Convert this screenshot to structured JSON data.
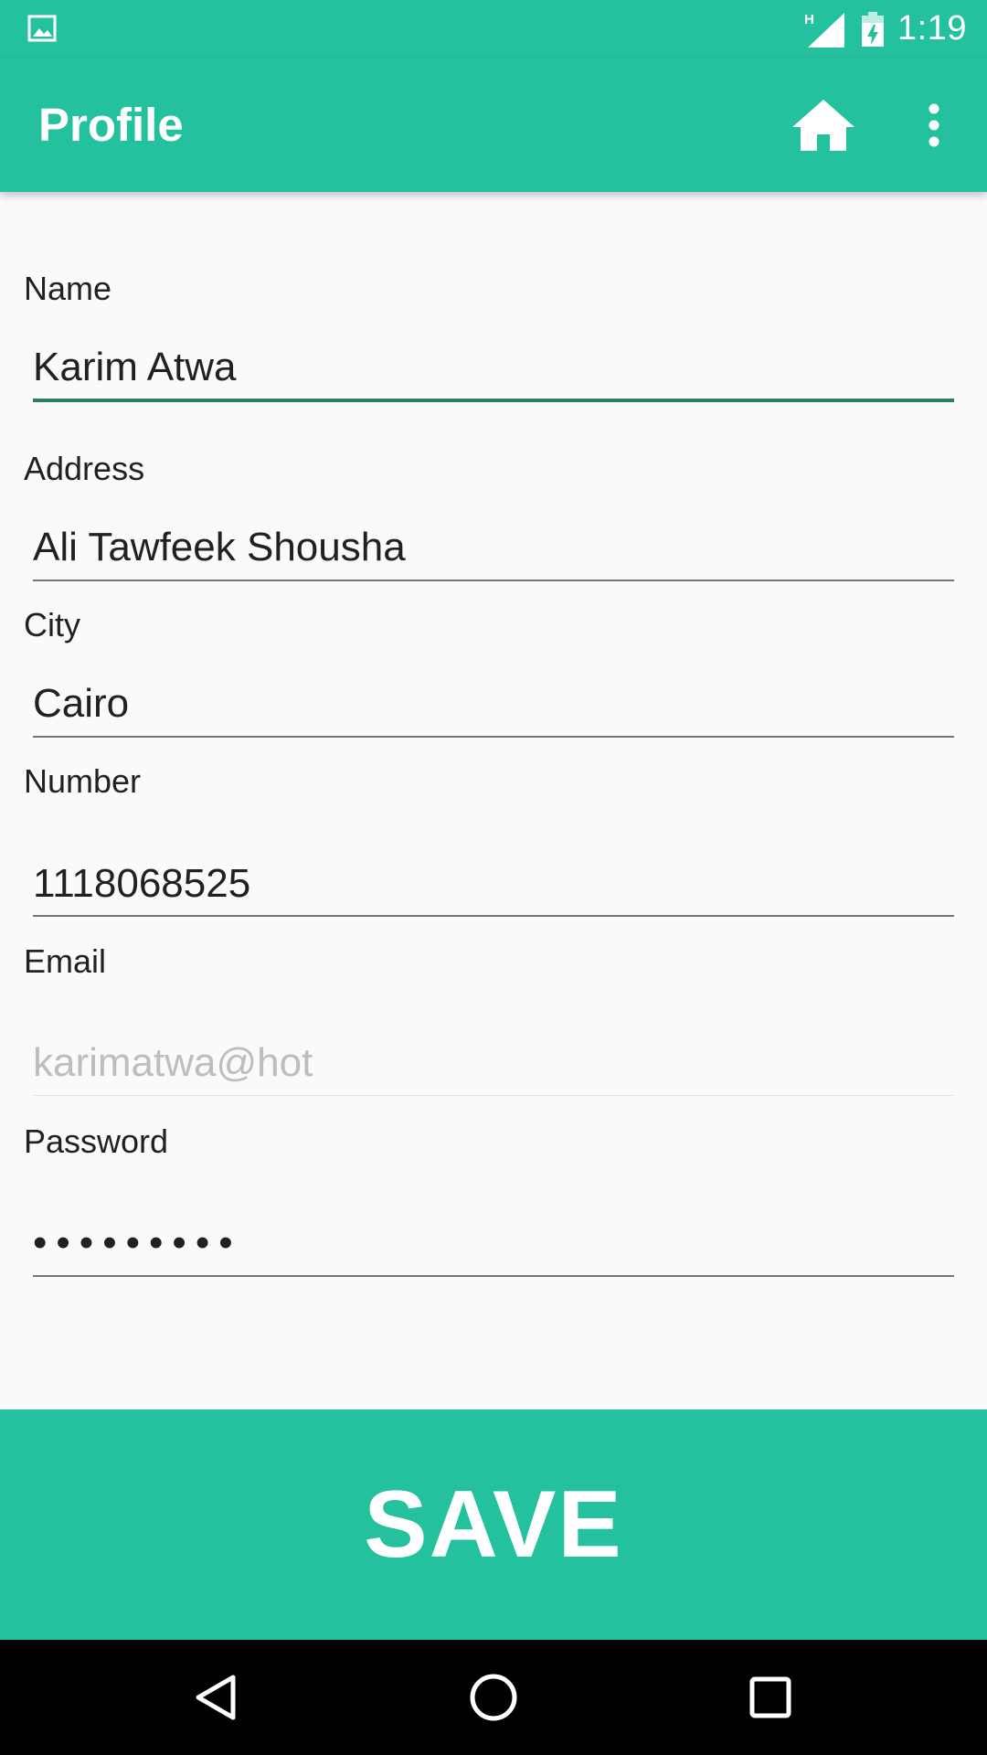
{
  "status_bar": {
    "time": "1:19",
    "network_type": "H",
    "left_icon": "image-icon",
    "signal_icon": "signal-icon",
    "battery_icon": "battery-charging-icon"
  },
  "app_bar": {
    "title": "Profile",
    "actions": [
      "home-icon",
      "more-vert-icon"
    ],
    "color": "#24C19E"
  },
  "form": {
    "name": {
      "label": "Name",
      "value": "Karim Atwa",
      "state": "focused"
    },
    "address": {
      "label": "Address",
      "value": "Ali Tawfeek Shousha"
    },
    "city": {
      "label": "City",
      "value": "Cairo"
    },
    "number": {
      "label": "Number",
      "value": "1118068525"
    },
    "email": {
      "label": "Email",
      "value": "karimatwa@hot",
      "state": "disabled"
    },
    "password": {
      "label": "Password",
      "value": "•••••••••"
    }
  },
  "save_button": {
    "label": "SAVE",
    "color": "#24C19E"
  },
  "nav_bar": {
    "buttons": [
      "back-icon",
      "home-circle-icon",
      "recents-icon"
    ]
  }
}
